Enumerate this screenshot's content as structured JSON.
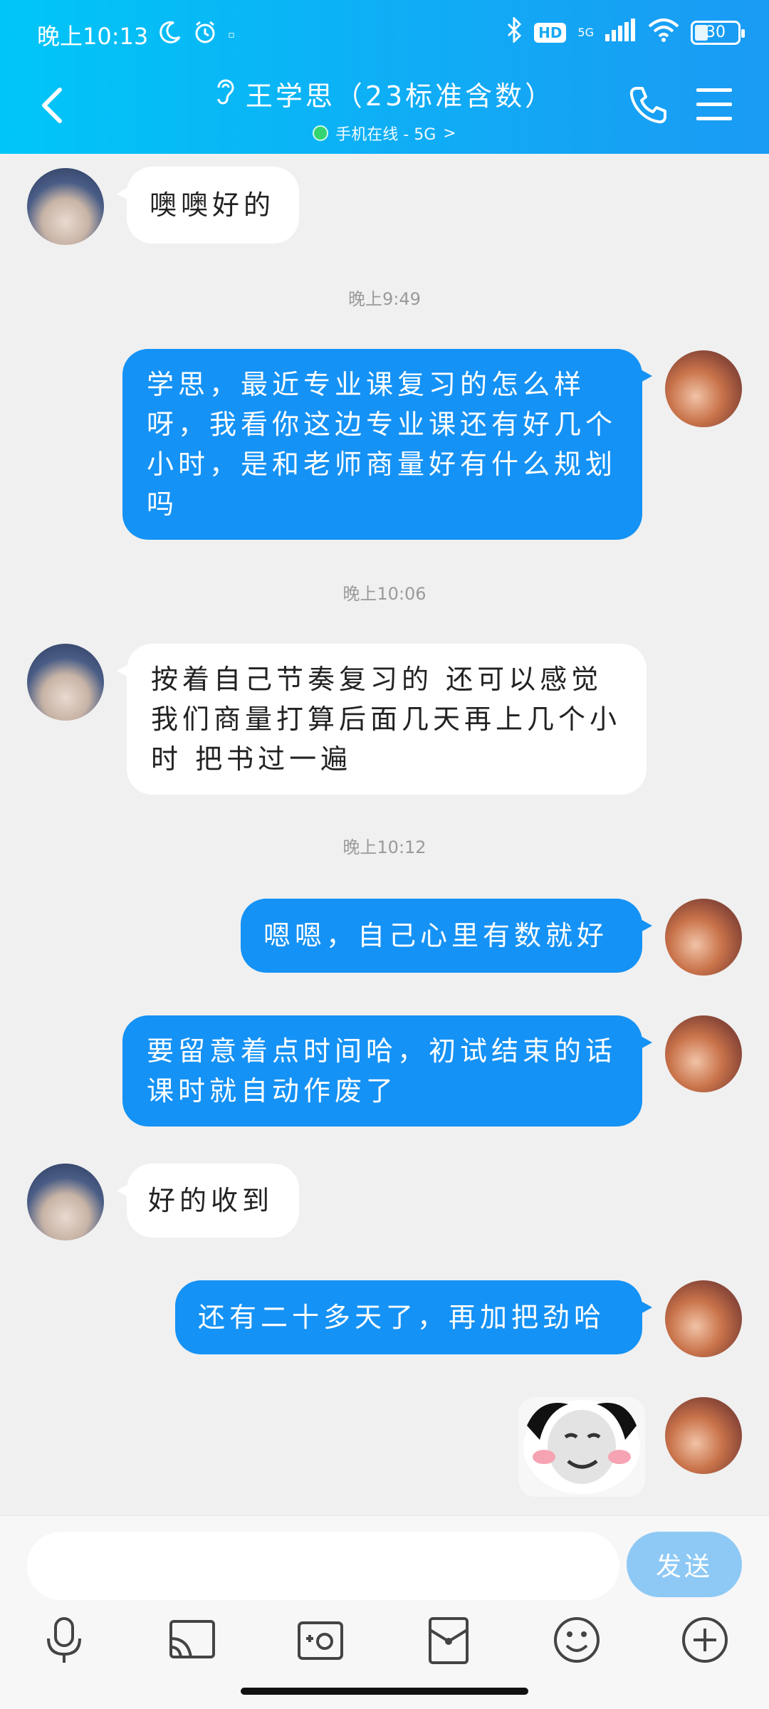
{
  "status_bar": {
    "time": "晚上10:13",
    "battery": "30",
    "network": "5G",
    "hd_badge": "HD"
  },
  "header": {
    "contact_name": "王学思（23标准含数）",
    "status_text": "手机在线 - 5G",
    "chevron": ">"
  },
  "messages": [
    {
      "side": "left",
      "text": "噢噢好的"
    },
    {
      "side": "time",
      "text": "晚上9:49"
    },
    {
      "side": "right",
      "text": "学思，最近专业课复习的怎么样呀，我看你这边专业课还有好几个小时，是和老师商量好有什么规划吗"
    },
    {
      "side": "time",
      "text": "晚上10:06"
    },
    {
      "side": "left",
      "text": "按着自己节奏复习的 还可以感觉我们商量打算后面几天再上几个小时 把书过一遍"
    },
    {
      "side": "time",
      "text": "晚上10:12"
    },
    {
      "side": "right",
      "text": "嗯嗯，自己心里有数就好"
    },
    {
      "side": "right",
      "text": "要留意着点时间哈，初试结束的话课时就自动作废了"
    },
    {
      "side": "left",
      "text": "好的收到"
    },
    {
      "side": "right",
      "text": "还有二十多天了，再加把劲哈"
    },
    {
      "side": "right",
      "text": "[sticker]"
    }
  ],
  "input": {
    "placeholder": "",
    "value": "",
    "send_label": "发送"
  },
  "toolbar": {
    "icons": [
      "microphone-icon",
      "cast-icon",
      "photo-icon",
      "red-packet-icon",
      "emoji-icon",
      "plus-icon"
    ]
  },
  "colors": {
    "header_start": "#00c6f7",
    "header_end": "#1a9bf4",
    "outgoing_bubble": "#1592f5",
    "incoming_bubble": "#ffffff",
    "send_button": "#8ec9f5",
    "online_dot": "#37d66a"
  }
}
